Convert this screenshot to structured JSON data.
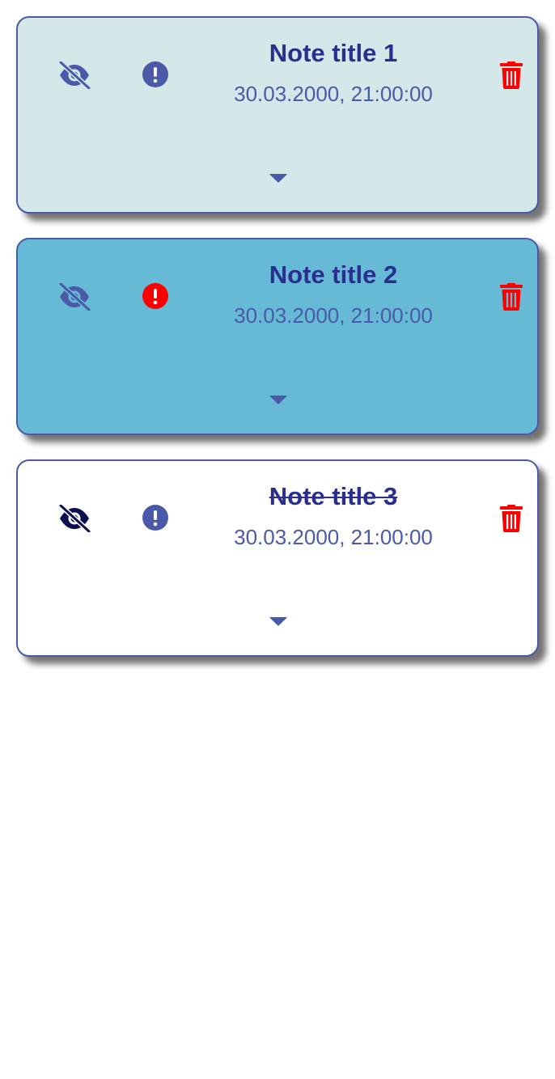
{
  "colors": {
    "accent": "#4a5aa8",
    "title": "#2a2f8f",
    "danger": "#ff0000",
    "eye_active": "#0d0d52",
    "card_light": "#d4e8ea",
    "card_blue": "#66bad6",
    "card_white": "#ffffff"
  },
  "notes": [
    {
      "title": "Note title 1",
      "date": "30.03.2000, 21:00:00",
      "hidden_icon": "eye-slash-icon",
      "important_icon": "exclamation-circle-icon",
      "delete_icon": "trash-icon",
      "expand_icon": "caret-down-icon",
      "important": false,
      "completed": false
    },
    {
      "title": "Note title 2",
      "date": "30.03.2000, 21:00:00",
      "hidden_icon": "eye-slash-icon",
      "important_icon": "exclamation-circle-icon",
      "delete_icon": "trash-icon",
      "expand_icon": "caret-down-icon",
      "important": true,
      "completed": false
    },
    {
      "title": "Note title 3",
      "date": "30.03.2000, 21:00:00",
      "hidden_icon": "eye-slash-icon",
      "important_icon": "exclamation-circle-icon",
      "delete_icon": "trash-icon",
      "expand_icon": "caret-down-icon",
      "important": false,
      "completed": true
    }
  ]
}
